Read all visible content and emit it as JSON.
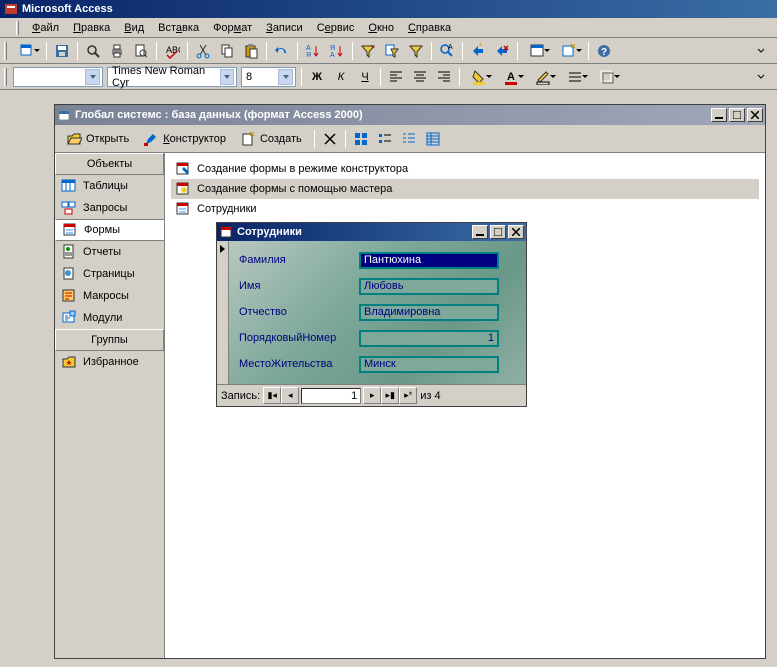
{
  "app": {
    "title": "Microsoft Access"
  },
  "menu": {
    "items": [
      "Файл",
      "Правка",
      "Вид",
      "Вставка",
      "Формат",
      "Записи",
      "Сервис",
      "Окно",
      "Справка"
    ]
  },
  "fmt_toolbar": {
    "font": "Times New Roman Cyr",
    "size": "8"
  },
  "db_window": {
    "title": "Глобал системс : база данных (формат Access 2000)",
    "toolbar": {
      "open": "Открыть",
      "design": "Конструктор",
      "new": "Создать"
    },
    "objects_hdr": "Объекты",
    "groups_hdr": "Группы",
    "objects": [
      "Таблицы",
      "Запросы",
      "Формы",
      "Отчеты",
      "Страницы",
      "Макросы",
      "Модули"
    ],
    "groups": [
      "Избранное"
    ],
    "list": [
      "Создание формы в режиме конструктора",
      "Создание формы с помощью мастера",
      "Сотрудники"
    ]
  },
  "form_window": {
    "title": "Сотрудники",
    "fields": [
      {
        "label": "Фамилия",
        "value": "Пантюхина"
      },
      {
        "label": "Имя",
        "value": "Любовь"
      },
      {
        "label": "Отчество",
        "value": "Владимировна"
      },
      {
        "label": "ПорядковыйНомер",
        "value": "1"
      },
      {
        "label": "МестоЖительства",
        "value": "Минск"
      }
    ],
    "nav": {
      "label": "Запись:",
      "current": "1",
      "total": "из  4"
    }
  }
}
